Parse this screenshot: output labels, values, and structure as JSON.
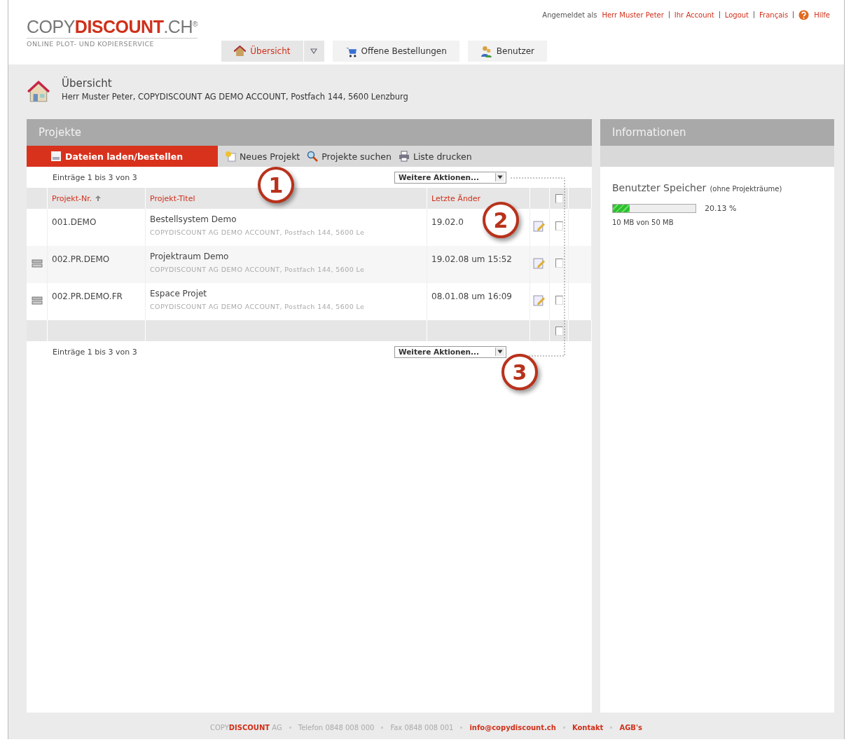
{
  "header": {
    "logo": {
      "part_1": "COPY",
      "part_2": "DISCOUNT",
      "part_3": ".CH",
      "mark": "®"
    },
    "tagline": "ONLINE PLOT- UND KOPIERSERVICE",
    "login_label": "Angemeldet als",
    "user_links": [
      "Herr Muster Peter",
      "Ihr Account",
      "Logout",
      "Français"
    ],
    "help": "Hilfe",
    "tabs": [
      {
        "label": "Übersicht",
        "selected": true,
        "kind": "house",
        "has_menu": true
      },
      {
        "label": "Offene Bestellungen",
        "selected": false,
        "kind": "cart",
        "has_menu": false
      },
      {
        "label": "Benutzer",
        "selected": false,
        "kind": "users",
        "has_menu": false
      }
    ]
  },
  "breadcrumb": {
    "title": "Übersicht",
    "subtitle": "Herr Muster Peter, COPYDISCOUNT AG DEMO ACCOUNT, Postfach 144, 5600 Lenzburg"
  },
  "projects": {
    "title": "Projekte",
    "toolbar": [
      {
        "kind": "primary",
        "label": "Dateien laden/bestellen"
      },
      {
        "kind": "new",
        "label": "Neues Projekt"
      },
      {
        "kind": "search",
        "label": "Projekte suchen"
      },
      {
        "kind": "print",
        "label": "Liste drucken"
      }
    ],
    "entries_top": "Einträge 1 bis 3 von 3",
    "actions_top": "Weitere Aktionen...",
    "columns": [
      "Projekt-Nr.",
      "Projekt-Titel",
      "Letzte Änder"
    ],
    "header_checked": false,
    "rows": [
      {
        "kind": "plain",
        "number": "001.DEMO",
        "title": "Bestellsystem Demo",
        "address": "COPYDISCOUNT AG DEMO ACCOUNT, Postfach 144, 5600 Le",
        "date": "19.02.0",
        "checked": false
      },
      {
        "kind": "room",
        "number": "002.PR.DEMO",
        "title": "Projektraum Demo",
        "address": "COPYDISCOUNT AG DEMO ACCOUNT, Postfach 144, 5600 Le",
        "date": "19.02.08 um 15:52",
        "checked": false
      },
      {
        "kind": "room",
        "number": "002.PR.DEMO.FR",
        "title": "Espace Projet",
        "address": "COPYDISCOUNT AG DEMO ACCOUNT, Postfach 144, 5600 Le",
        "date": "08.01.08 um 16:09",
        "checked": false
      }
    ],
    "footer_checked": false,
    "entries_bottom": "Einträge 1 bis 3 von 3",
    "actions_bottom": "Weitere Aktionen...",
    "callouts": [
      "1",
      "2",
      "3"
    ]
  },
  "info": {
    "title": "Informationen",
    "storage_title": "Benutzter Speicher",
    "storage_note": "(ohne Projekträume)",
    "level": 0.2013,
    "percent": "20.13 %",
    "usage": "10 MB von 50 MB"
  },
  "footer": {
    "brand_1": "COPY",
    "brand_2": "DISCOUNT",
    "brand_3": "AG",
    "phone": "Telefon 0848 008 000",
    "fax": "Fax 0848 008 001",
    "links": [
      "info@copydiscount.ch",
      "Kontakt",
      "AGB's"
    ]
  }
}
